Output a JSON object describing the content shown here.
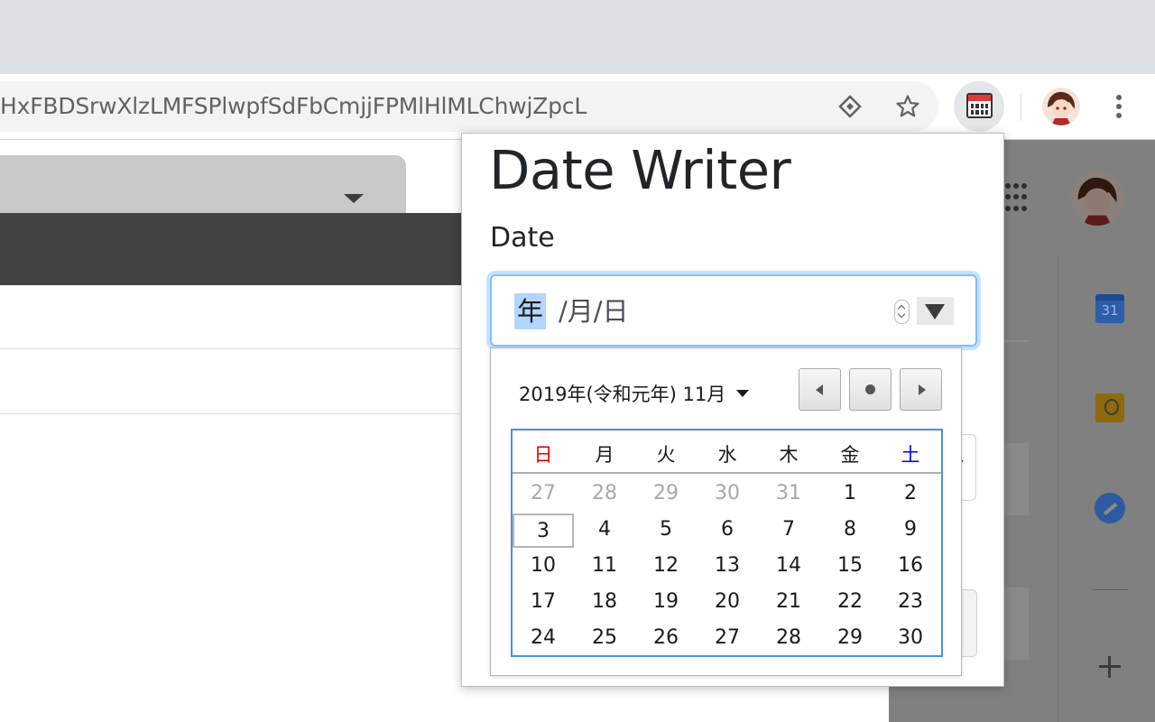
{
  "browser": {
    "url": "HxFBDSrwXlzLMFSPlwpfSdFbCmjjFPMlHlMLChwjZpcL",
    "icons": [
      "translate-icon",
      "star-icon",
      "date-writer-extension-icon",
      "profile-avatar",
      "menu-icon"
    ]
  },
  "page": {
    "side_apps": [
      "calendar-app-icon",
      "keep-app-icon",
      "tasks-app-icon",
      "add-icon"
    ],
    "calendar_app_day": "31"
  },
  "popup": {
    "title": "Date Writer",
    "date_label": "Date",
    "date_input": {
      "year_placeholder": "年",
      "rest_placeholder": "/月/日"
    },
    "calendar": {
      "month_label": "2019年(令和元年) 11月",
      "weekdays": [
        "日",
        "月",
        "火",
        "水",
        "木",
        "金",
        "土"
      ],
      "weeks": [
        [
          "27",
          "28",
          "29",
          "30",
          "31",
          "1",
          "2"
        ],
        [
          "3",
          "4",
          "5",
          "6",
          "7",
          "8",
          "9"
        ],
        [
          "10",
          "11",
          "12",
          "13",
          "14",
          "15",
          "16"
        ],
        [
          "17",
          "18",
          "19",
          "20",
          "21",
          "22",
          "23"
        ],
        [
          "24",
          "25",
          "26",
          "27",
          "28",
          "29",
          "30"
        ]
      ],
      "outside_month_days": [
        "27",
        "28",
        "29",
        "30",
        "31"
      ],
      "highlighted_day": "3",
      "colors": {
        "sunday": "#e00000",
        "saturday": "#0000e0",
        "grid_border": "#4a90e2",
        "focus_ring": "#80bdff",
        "selection": "#b4d5fe"
      }
    }
  }
}
